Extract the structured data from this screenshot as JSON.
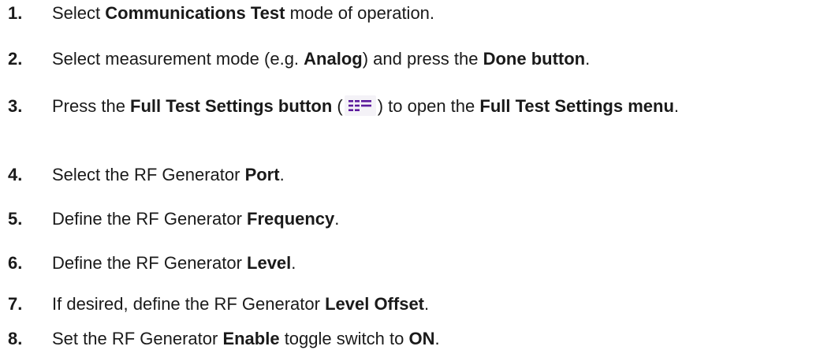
{
  "steps": [
    {
      "num": "1.",
      "pre": "Select ",
      "b1": "Communications Test",
      "post": " mode of operation."
    },
    {
      "num": "2.",
      "pre": "Select measurement mode (e.g. ",
      "b1": "Analog",
      "mid": ") and press the ",
      "b2": "Done button",
      "post": "."
    },
    {
      "num": "3.",
      "pre": "Press the ",
      "b1": "Full Test Settings button",
      "mid1": " (",
      "icon": "full-test-settings-icon",
      "mid2": ") to open the ",
      "b2": "Full Test Settings menu",
      "post": "."
    },
    {
      "num": "4.",
      "pre": "Select the RF Generator ",
      "b1": "Port",
      "post": "."
    },
    {
      "num": "5.",
      "pre": "Define the RF Generator ",
      "b1": "Frequency",
      "post": "."
    },
    {
      "num": "6.",
      "pre": "Define the RF Generator ",
      "b1": "Level",
      "post": "."
    },
    {
      "num": "7.",
      "pre": "If desired, define the RF Generator ",
      "b1": "Level Offset",
      "post": "."
    },
    {
      "num": "8.",
      "pre": "Set the RF Generator ",
      "b1": "Enable",
      "mid": " toggle switch to ",
      "b2": "ON",
      "post": "."
    }
  ],
  "colors": {
    "text": "#1a1a1a",
    "icon_purple": "#5b1a9c"
  }
}
